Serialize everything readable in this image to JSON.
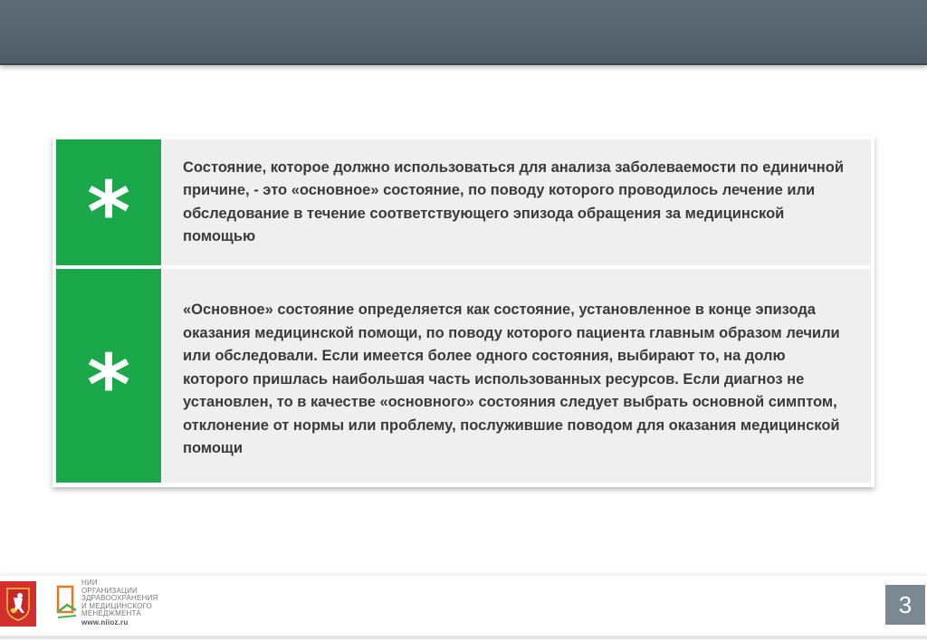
{
  "slide": {
    "items": [
      {
        "bullet": "*",
        "text": "Состояние, которое должно использоваться для анализа заболеваемости по единичной причине, - это «основное» состояние, по поводу которого проводилось лечение или обследование в течение соответствующего эпизода обращения за медицинской помощью"
      },
      {
        "bullet": "*",
        "text": "«Основное» состояние определяется как состояние, установленное в конце эпизода оказания медицинской помощи, по поводу которого пациента главным образом лечили или обследовали. Если имеется более одного состояния, выбирают то, на долю которого пришлась наибольшая часть использованных ресурсов. Если диагноз не установлен, то в качестве «основного» состояния следует выбрать основной симптом, отклонение от нормы или проблему, послужившие поводом для оказания медицинской помощи"
      }
    ],
    "page_number": "3"
  },
  "footer": {
    "org_lines": [
      "НИИ",
      "ОРГАНИЗАЦИИ",
      "ЗДРАВООХРАНЕНИЯ",
      "И МЕДИЦИНСКОГО",
      "МЕНЕДЖМЕНТА"
    ],
    "org_url": "www.niioz.ru",
    "icons": {
      "emblem": "moscow-coat-of-arms-icon",
      "logo": "niioz-logo-icon"
    }
  },
  "colors": {
    "header_bar": "#55636e",
    "accent_green": "#1aa84a",
    "text_box_bg": "#efefef",
    "text": "#3a3a3a",
    "page_number_bg": "#7b8891",
    "emblem_red": "#d32f2f"
  }
}
